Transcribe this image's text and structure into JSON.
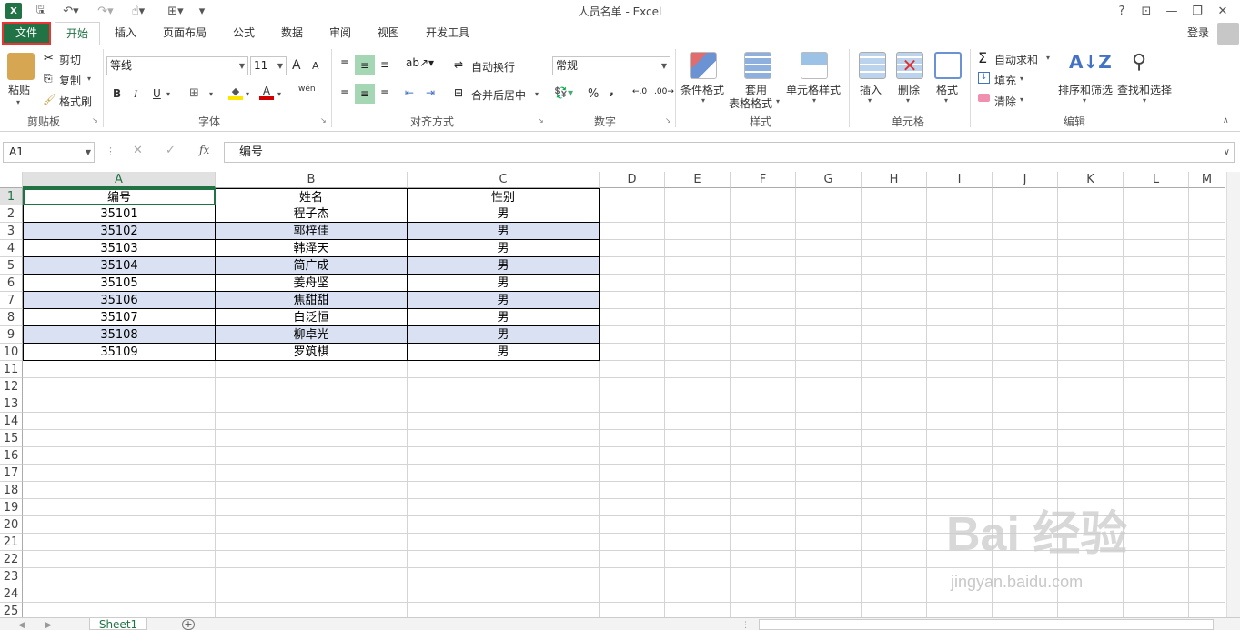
{
  "window": {
    "title": "人员名单 - Excel",
    "help": "?",
    "minimize": "—",
    "restore": "❐",
    "close": "✕",
    "login": "登录"
  },
  "tabs": [
    {
      "label": "文件"
    },
    {
      "label": "开始"
    },
    {
      "label": "插入"
    },
    {
      "label": "页面布局"
    },
    {
      "label": "公式"
    },
    {
      "label": "数据"
    },
    {
      "label": "审阅"
    },
    {
      "label": "视图"
    },
    {
      "label": "开发工具"
    }
  ],
  "ribbon": {
    "clipboard": {
      "paste": "粘贴",
      "cut": "剪切",
      "copy": "复制",
      "format_painter": "格式刷",
      "label": "剪贴板"
    },
    "font": {
      "name": "等线",
      "size": "11",
      "label": "字体",
      "bold": "B",
      "italic": "I",
      "underline": "U",
      "grow": "A",
      "shrink": "A",
      "wen": "wén"
    },
    "alignment": {
      "wrap": "自动换行",
      "merge": "合并后居中",
      "label": "对齐方式"
    },
    "number": {
      "format": "常规",
      "percent": "%",
      "comma": ",",
      "label": "数字"
    },
    "styles": {
      "conditional": "条件格式",
      "table_1": "套用",
      "table_2": "表格格式",
      "cell_styles": "单元格样式",
      "label": "样式"
    },
    "cells": {
      "insert": "插入",
      "delete": "删除",
      "format": "格式",
      "label": "单元格"
    },
    "editing": {
      "autosum": "自动求和",
      "fill": "填充",
      "clear": "清除",
      "sort": "排序和筛选",
      "find": "查找和选择",
      "label": "编辑"
    }
  },
  "formula_bar": {
    "name_box": "A1",
    "fx": "fx",
    "cancel": "✕",
    "enter": "✓",
    "value": "编号"
  },
  "columns": [
    "A",
    "B",
    "C",
    "D",
    "E",
    "F",
    "G",
    "H",
    "I",
    "J",
    "K",
    "L",
    "M"
  ],
  "rows": [
    "1",
    "2",
    "3",
    "4",
    "5",
    "6",
    "7",
    "8",
    "9",
    "10",
    "11",
    "12",
    "13",
    "14",
    "15",
    "16",
    "17",
    "18",
    "19",
    "20",
    "21",
    "22",
    "23",
    "24",
    "25"
  ],
  "table": {
    "headers": [
      "编号",
      "姓名",
      "性别"
    ],
    "data": [
      [
        "35101",
        "程子杰",
        "男"
      ],
      [
        "35102",
        "郭梓佳",
        "男"
      ],
      [
        "35103",
        "韩泽天",
        "男"
      ],
      [
        "35104",
        "简广成",
        "男"
      ],
      [
        "35105",
        "姜舟坚",
        "男"
      ],
      [
        "35106",
        "焦甜甜",
        "男"
      ],
      [
        "35107",
        "白泛恒",
        "男"
      ],
      [
        "35108",
        "柳卓光",
        "男"
      ],
      [
        "35109",
        "罗筑棋",
        "男"
      ]
    ]
  },
  "sheets": [
    {
      "label": "Sheet1"
    }
  ],
  "watermark": {
    "main": "Bai 经验",
    "sub": "jingyan.baidu.com"
  },
  "colors": {
    "excel_green": "#217346",
    "band": "#d9e1f2",
    "highlight_red": "#e33333"
  }
}
